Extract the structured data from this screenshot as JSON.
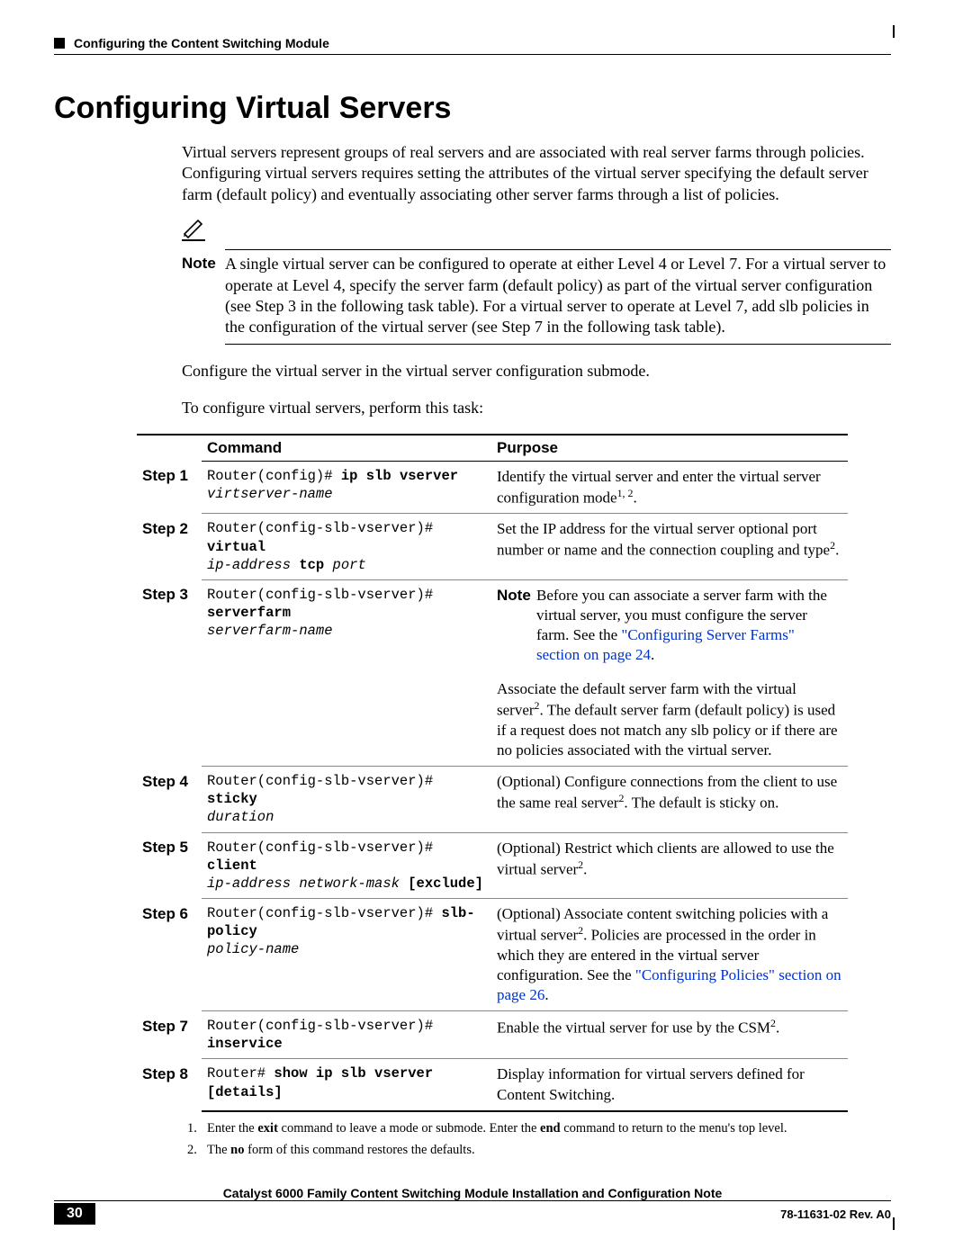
{
  "header": {
    "section_title": "Configuring the Content Switching Module"
  },
  "title": "Configuring Virtual Servers",
  "intro": "Virtual servers represent groups of real servers and are associated with real server farms through policies. Configuring virtual servers requires setting the attributes of the virtual server specifying the default server farm (default policy) and eventually associating other server farms through a list of policies.",
  "note": {
    "label": "Note",
    "text": "A single virtual server can be configured to operate at either Level 4 or Level 7. For a virtual server to operate at Level 4, specify the server farm (default policy) as part of the virtual server configuration (see Step 3 in the following task table). For a virtual server to operate at Level 7, add slb policies in the configuration of the virtual server (see Step 7 in the following task table)."
  },
  "pretable": {
    "line1": "Configure the virtual server in the virtual server configuration submode.",
    "line2": "To configure virtual servers, perform this task:"
  },
  "table": {
    "head_command": "Command",
    "head_purpose": "Purpose",
    "rows": [
      {
        "step": "Step 1",
        "cmd_prefix": "Router(config)# ",
        "cmd_bold": "ip slb vserver",
        "cmd_italic": "virtserver-name",
        "purpose_pre": "Identify the virtual server and enter the virtual server configuration mode",
        "purpose_sup": "1, 2",
        "purpose_post": "."
      },
      {
        "step": "Step 2",
        "cmd_prefix": "Router(config-slb-vserver)# ",
        "cmd_bold": "virtual",
        "cmd_italic": "ip-address ",
        "cmd_bold2": "tcp",
        "cmd_italic2": " port",
        "purpose_pre": "Set the IP address for the virtual server optional port number or name and the connection coupling and type",
        "purpose_sup": "2",
        "purpose_post": "."
      },
      {
        "step": "Step 3",
        "cmd_prefix": "Router(config-slb-vserver)# ",
        "cmd_bold": "serverfarm",
        "cmd_italic": "serverfarm-name",
        "note_label": "Note",
        "note_text_pre": "Before you can associate a server farm with the virtual server, you must configure the server farm. See the ",
        "note_link": "\"Configuring Server Farms\" section on page 24",
        "note_text_post": ".",
        "purpose_pre": "Associate the default server farm with the virtual server",
        "purpose_sup": "2",
        "purpose_post": ". The default server farm (default policy) is used if a request does not match any slb policy or if there are no policies associated with the virtual server."
      },
      {
        "step": "Step 4",
        "cmd_prefix": "Router(config-slb-vserver)# ",
        "cmd_bold": "sticky",
        "cmd_italic": "duration",
        "purpose_pre": "(Optional) Configure connections from the client to use the same real server",
        "purpose_sup": "2",
        "purpose_post": ". The default is sticky on."
      },
      {
        "step": "Step 5",
        "cmd_prefix": "Router(config-slb-vserver)# ",
        "cmd_bold": "client",
        "cmd_italic": "ip-address network-mask ",
        "cmd_bold2_bracket": "[exclude]",
        "purpose_pre": "(Optional) Restrict which clients are allowed to use the virtual server",
        "purpose_sup": "2",
        "purpose_post": "."
      },
      {
        "step": "Step 6",
        "cmd_prefix": "Router(config-slb-vserver)# ",
        "cmd_bold": "slb-policy",
        "cmd_italic": "policy-name",
        "purpose_pre": "(Optional) Associate content switching policies with a virtual server",
        "purpose_sup": "2",
        "purpose_post": ". Policies are processed in the order in which they are entered in the virtual server configuration. See the ",
        "purpose_link": "\"Configuring Policies\" section on page 26",
        "purpose_post2": "."
      },
      {
        "step": "Step 7",
        "cmd_prefix": "Router(config-slb-vserver)# ",
        "cmd_bold": "inservice",
        "purpose_pre": "Enable the virtual server for use by the CSM",
        "purpose_sup": "2",
        "purpose_post": "."
      },
      {
        "step": "Step 8",
        "cmd_prefix": "Router# ",
        "cmd_bold": "show ip slb vserver ",
        "cmd_bold2_bracket": "[details]",
        "purpose_pre": "Display information for virtual servers defined for Content Switching."
      }
    ]
  },
  "footnotes": {
    "f1_pre": "Enter the ",
    "f1_b1": "exit",
    "f1_mid": " command to leave a mode or submode. Enter the ",
    "f1_b2": "end",
    "f1_post": " command to return to the menu's  top level.",
    "f2_pre": "The ",
    "f2_b": "no",
    "f2_post": " form of this command restores the defaults."
  },
  "footer": {
    "title": "Catalyst 6000 Family Content Switching Module Installation and Configuration Note",
    "page": "30",
    "docid": "78-11631-02 Rev. A0"
  }
}
